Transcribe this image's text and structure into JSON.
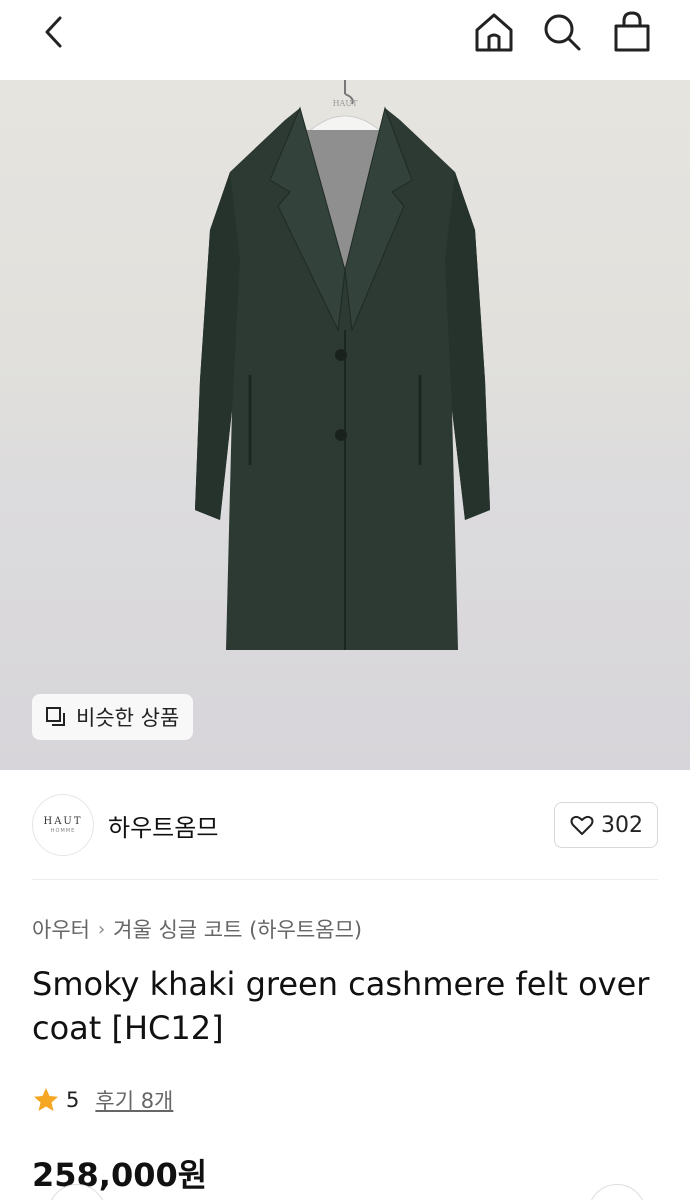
{
  "header": {
    "back_icon": "chevron-left-icon",
    "home_icon": "home-icon",
    "search_icon": "search-icon",
    "bag_icon": "shopping-bag-icon"
  },
  "hero": {
    "hanger_label": "HAUT",
    "coat_color": "#2c3a33",
    "similar_label": "비슷한 상품"
  },
  "brand": {
    "logo_text": "HAUT",
    "logo_subtext": "HOMME",
    "name": "하우트옴므",
    "likes": "302"
  },
  "breadcrumb": {
    "category": "아우터",
    "subcategory": "겨울 싱글 코트 (하우트옴므)"
  },
  "product": {
    "title": "Smoky khaki green cashmere felt over coat [HC12]",
    "rating": "5",
    "reviews_label": "후기 8개",
    "price": "258,000원"
  },
  "colors": {
    "star": "#f5a623",
    "text": "#111111",
    "muted": "#666666"
  }
}
